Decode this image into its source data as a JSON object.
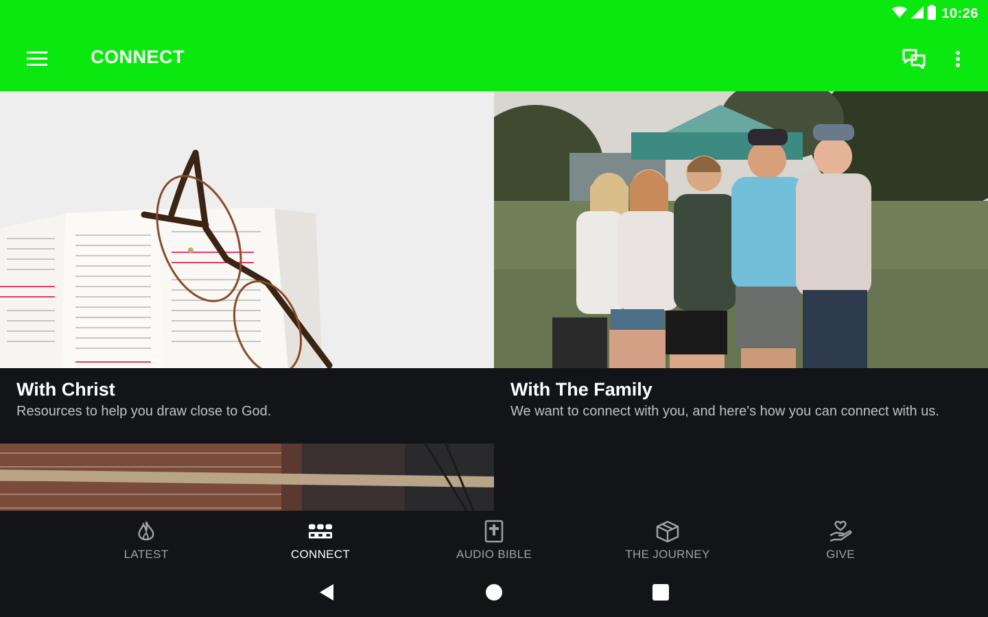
{
  "status_bar": {
    "time": "10:26",
    "icons": [
      "wifi-icon",
      "cell-signal-icon",
      "battery-icon"
    ]
  },
  "app_bar": {
    "title": "CONNECT",
    "menu_icon": "hamburger-menu-icon",
    "actions": [
      "chat-icon",
      "more-vert-icon"
    ],
    "background_color": "#0ae80f"
  },
  "cards": [
    {
      "title": "With Christ",
      "description": "Resources to help you draw close to God.",
      "image": "open bible with glasses"
    },
    {
      "title": "With The Family",
      "description": "We want to connect with you, and here's how you can connect with us.",
      "image": "group of five teenagers outdoors"
    }
  ],
  "bottom_nav": {
    "items": [
      {
        "label": "LATEST",
        "icon": "flame-icon",
        "active": false
      },
      {
        "label": "CONNECT",
        "icon": "group-icon",
        "active": true
      },
      {
        "label": "AUDIO BIBLE",
        "icon": "bible-icon",
        "active": false
      },
      {
        "label": "THE JOURNEY",
        "icon": "box-icon",
        "active": false
      },
      {
        "label": "GIVE",
        "icon": "giving-hand-icon",
        "active": false
      }
    ]
  },
  "system_nav": [
    "back-icon",
    "home-icon",
    "recents-icon"
  ]
}
